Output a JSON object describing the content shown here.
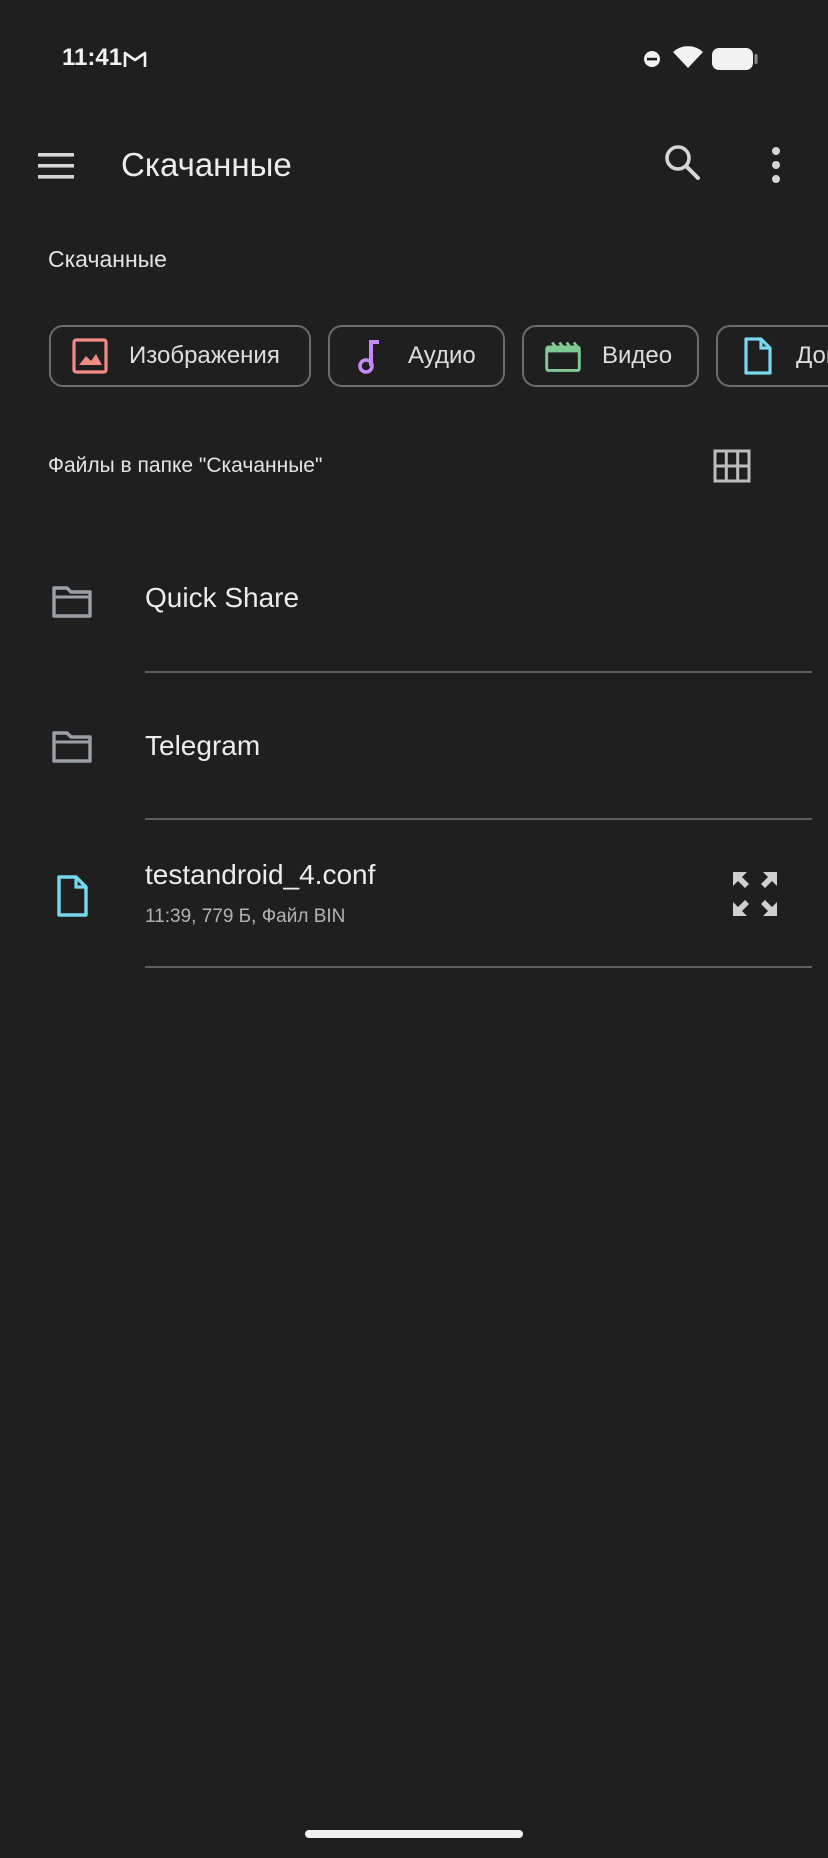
{
  "status_bar": {
    "time": "11:41",
    "icons": [
      "gmail-icon",
      "dnd-icon",
      "wifi-icon",
      "battery-icon"
    ]
  },
  "app_bar": {
    "title": "Скачанные",
    "icons": [
      "menu-icon",
      "search-icon",
      "more-vert-icon"
    ]
  },
  "breadcrumb": {
    "label": "Скачанные"
  },
  "chips": [
    {
      "label": "Изображения",
      "icon": "image-icon",
      "color": "#f28b82"
    },
    {
      "label": "Аудио",
      "icon": "music-note-icon",
      "color": "#c58af9"
    },
    {
      "label": "Видео",
      "icon": "movie-icon",
      "color": "#81c995"
    },
    {
      "label": "Документы",
      "icon": "document-icon",
      "color": "#78d9ec"
    }
  ],
  "section": {
    "label": "Файлы в папке \"Скачанные\"",
    "view_toggle_icon": "grid-view-icon"
  },
  "files": [
    {
      "name": "Quick Share",
      "type": "folder",
      "icon": "folder-icon",
      "meta": ""
    },
    {
      "name": "Telegram",
      "type": "folder",
      "icon": "folder-icon",
      "meta": ""
    },
    {
      "name": "testandroid_4.conf",
      "type": "file",
      "icon": "document-icon",
      "meta": "11:39, 779 Б, Файл BIN",
      "action_icon": "expand-icon"
    }
  ],
  "colors": {
    "background": "#1f1f1f",
    "divider": "#5e5e5e",
    "chip_border": "#6c6c6c",
    "folder_icon": "#9aa0a6",
    "document_icon": "#78d9ec"
  }
}
